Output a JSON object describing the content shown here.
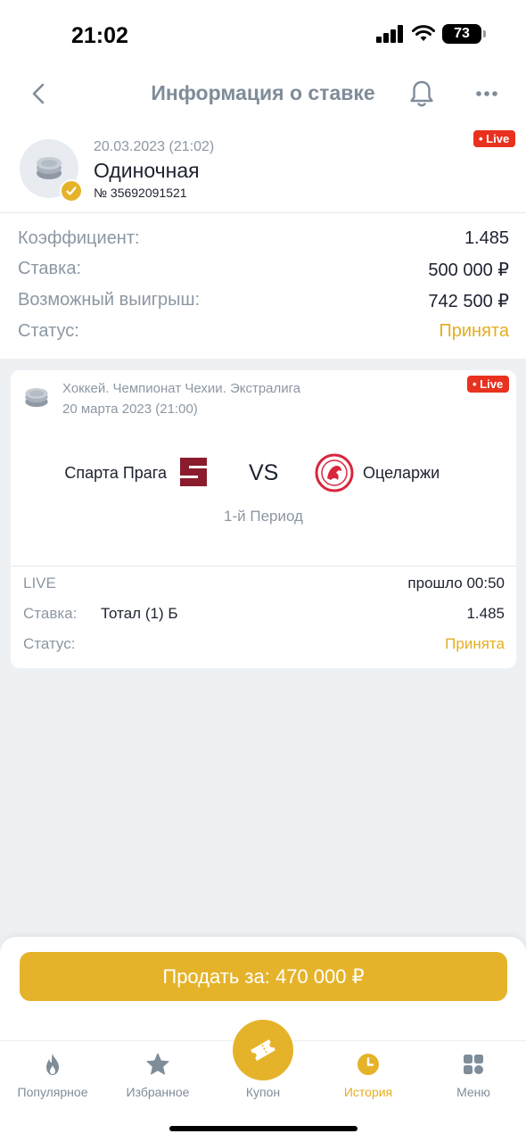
{
  "status_bar": {
    "time": "21:02",
    "battery": "73"
  },
  "header": {
    "title": "Информация о ставке"
  },
  "bet": {
    "date": "20.03.2023 (21:02)",
    "type": "Одиночная",
    "number": "№ 35692091521",
    "live_label": "• Live",
    "coefficient_label": "Коэффициент:",
    "coefficient_value": "1.485",
    "stake_label": "Ставка:",
    "stake_value": "500 000 ₽",
    "win_label": "Возможный выигрыш:",
    "win_value": "742 500 ₽",
    "status_label": "Статус:",
    "status_value": "Принята"
  },
  "event": {
    "league": "Хоккей. Чемпионат Чехии. Экстралига",
    "date": "20 марта 2023 (21:00)",
    "live_label": "• Live",
    "team1": "Спарта Прага",
    "vs": "VS",
    "team2": "Оцеларжи",
    "period": "1-й Период",
    "live_text": "LIVE",
    "elapsed": "прошло 00:50",
    "stake_label": "Ставка:",
    "stake_pick": "Тотал (1) Б",
    "stake_coef": "1.485",
    "status_label": "Статус:",
    "status_value": "Принята"
  },
  "sell": {
    "label": "Продать за: 470 000 ₽"
  },
  "tabs": [
    {
      "label": "Популярное",
      "icon": "fire-icon"
    },
    {
      "label": "Избранное",
      "icon": "star-icon"
    },
    {
      "label": "Купон",
      "icon": "ticket-icon"
    },
    {
      "label": "История",
      "icon": "clock-icon"
    },
    {
      "label": "Меню",
      "icon": "grid-icon"
    }
  ],
  "colors": {
    "accent": "#e5b32a",
    "live": "#e8321f",
    "muted": "#8c97a3"
  }
}
